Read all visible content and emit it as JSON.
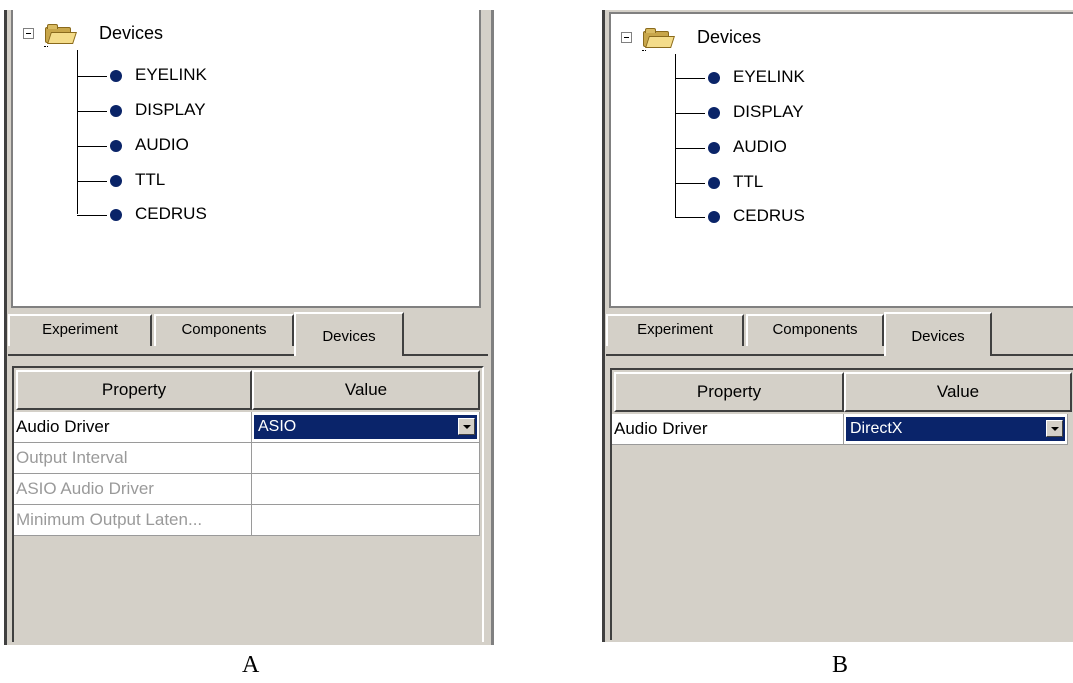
{
  "panels": {
    "a": {
      "tree": {
        "root_label": "Devices",
        "items": [
          {
            "label": "EYELINK"
          },
          {
            "label": "DISPLAY"
          },
          {
            "label": "AUDIO"
          },
          {
            "label": "TTL"
          },
          {
            "label": "CEDRUS"
          }
        ]
      },
      "tabs": [
        {
          "label": "Experiment"
        },
        {
          "label": "Components"
        },
        {
          "label": "Devices"
        }
      ],
      "grid": {
        "headers": {
          "property": "Property",
          "value": "Value"
        },
        "rows": [
          {
            "property": "Audio Driver",
            "value": "ASIO"
          },
          {
            "property": "Output Interval",
            "value": ""
          },
          {
            "property": "ASIO Audio Driver",
            "value": ""
          },
          {
            "property": "Minimum Output Laten...",
            "value": ""
          }
        ]
      },
      "caption": "A"
    },
    "b": {
      "tree": {
        "root_label": "Devices",
        "items": [
          {
            "label": "EYELINK"
          },
          {
            "label": "DISPLAY"
          },
          {
            "label": "AUDIO"
          },
          {
            "label": "TTL"
          },
          {
            "label": "CEDRUS"
          }
        ]
      },
      "tabs": [
        {
          "label": "Experiment"
        },
        {
          "label": "Components"
        },
        {
          "label": "Devices"
        }
      ],
      "grid": {
        "headers": {
          "property": "Property",
          "value": "Value"
        },
        "rows": [
          {
            "property": "Audio Driver",
            "value": "DirectX"
          }
        ]
      },
      "caption": "B"
    }
  },
  "colors": {
    "panel_bg": "#d4d0c8",
    "selection": "#0a246a",
    "bullet": "#0a2468",
    "disabled_text": "#9a9a9a"
  },
  "icons": {
    "expander": "minus-box-icon",
    "root": "folder-icon",
    "bullet": "bullet-dot-icon",
    "dropdown": "dropdown-arrow-icon"
  }
}
